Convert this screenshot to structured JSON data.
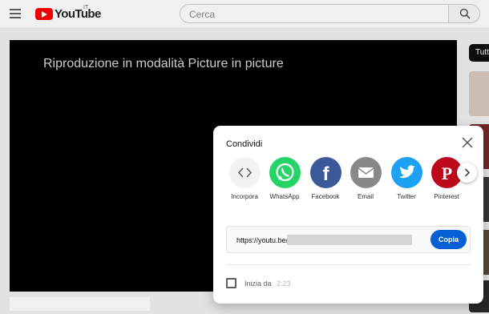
{
  "header": {
    "logo_text": "YouTube",
    "country_code": "IT",
    "search": {
      "placeholder": "Cerca",
      "value": ""
    }
  },
  "player": {
    "overlay_text": "Riproduzione in modalità Picture in picture"
  },
  "sidebar": {
    "chip_label": "Tutti"
  },
  "share_dialog": {
    "title": "Condividi",
    "targets": [
      {
        "label": "Incorpora",
        "icon": "embed-icon",
        "color": "#f2f2f2"
      },
      {
        "label": "WhatsApp",
        "icon": "whatsapp-icon",
        "color": "#25d366"
      },
      {
        "label": "Facebook",
        "icon": "facebook-icon",
        "color": "#3b5998"
      },
      {
        "label": "Email",
        "icon": "email-icon",
        "color": "#888888"
      },
      {
        "label": "Twitter",
        "icon": "twitter-icon",
        "color": "#1da1f2"
      },
      {
        "label": "Pinterest",
        "icon": "pinterest-icon",
        "color": "#bd081c"
      }
    ],
    "link": "https://youtu.be/",
    "copy_label": "Copia",
    "start_at": {
      "label": "Inizia da",
      "time": "2:23",
      "checked": false
    }
  },
  "colors": {
    "brand_red": "#ff0000",
    "accent_blue": "#065fd4"
  }
}
